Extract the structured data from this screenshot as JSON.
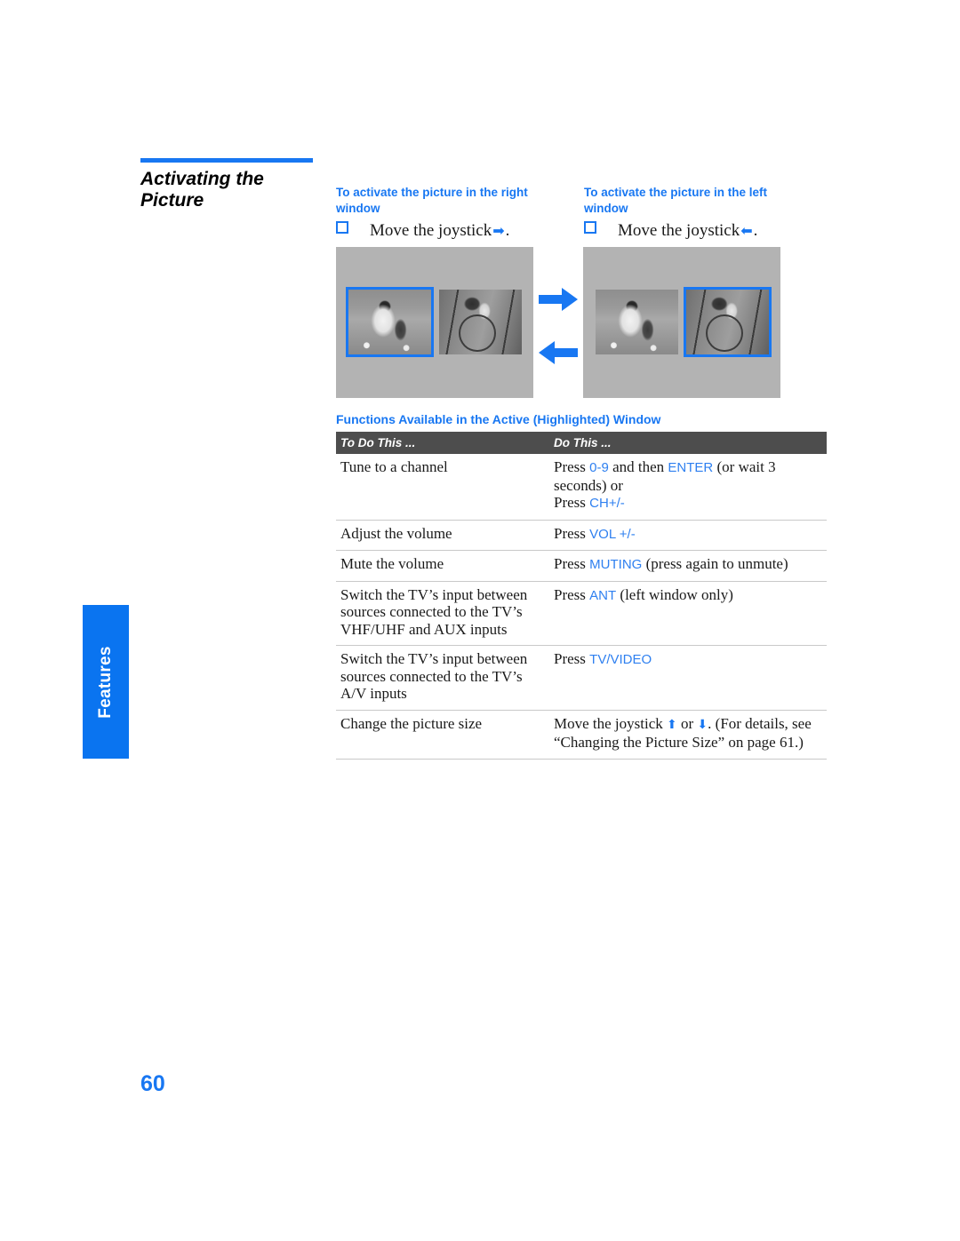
{
  "side_tab": {
    "label": "Features"
  },
  "heading": {
    "line1": "Activating the",
    "line2": "Picture"
  },
  "folio": {
    "page_number": "60"
  },
  "colors": {
    "accent_blue": "#1877f2",
    "keyword_blue": "#2f80f0",
    "table_header_gray": "#4d4d4d",
    "panel_gray": "#b3b3b3"
  },
  "instructions": [
    {
      "title": "To activate the picture in the right window",
      "bullet_icon": "empty-square-bullet",
      "text_before": "Move the joystick",
      "arrow_icon": "arrow-right-icon",
      "arrow_glyph": "➡",
      "text_after": "."
    },
    {
      "title": "To activate the picture in the left window",
      "bullet_icon": "empty-square-bullet",
      "text_before": "Move the joystick",
      "arrow_icon": "arrow-left-icon",
      "arrow_glyph": "⬅",
      "text_after": "."
    }
  ],
  "figures": {
    "left_panel": {
      "caption_role": "left-window-highlighted",
      "thumb_left": "soccer-photo",
      "thumb_right": "basketball-photo",
      "highlighted": "left"
    },
    "right_panel": {
      "caption_role": "right-window-highlighted",
      "thumb_left": "soccer-photo",
      "thumb_right": "basketball-photo",
      "highlighted": "right"
    },
    "arrows": {
      "top": "arrow-right-icon",
      "bottom": "arrow-left-icon"
    }
  },
  "table": {
    "caption": "Functions Available in the Active (Highlighted) Window",
    "headers": [
      "To Do This ...",
      "Do This ..."
    ],
    "rows": [
      {
        "to_do": "Tune to a channel",
        "do_this_parts": [
          {
            "t": "Press ",
            "k": false
          },
          {
            "t": "0-9",
            "k": true
          },
          {
            "t": " and then ",
            "k": false
          },
          {
            "t": "ENTER",
            "k": true
          },
          {
            "t": " (or wait 3 seconds) or",
            "k": false
          },
          {
            "t": "\n",
            "k": false
          },
          {
            "t": "Press ",
            "k": false
          },
          {
            "t": "CH+/-",
            "k": true
          }
        ]
      },
      {
        "to_do": "Adjust the volume",
        "do_this_parts": [
          {
            "t": "Press ",
            "k": false
          },
          {
            "t": "VOL +/-",
            "k": true
          }
        ]
      },
      {
        "to_do": "Mute the volume",
        "do_this_parts": [
          {
            "t": "Press ",
            "k": false
          },
          {
            "t": "MUTING",
            "k": true
          },
          {
            "t": " (press again to unmute)",
            "k": false
          }
        ]
      },
      {
        "to_do": "Switch the TV’s input between sources connected to the TV’s VHF/UHF and AUX inputs",
        "do_this_parts": [
          {
            "t": "Press ",
            "k": false
          },
          {
            "t": "ANT",
            "k": true
          },
          {
            "t": " (left window only)",
            "k": false
          }
        ]
      },
      {
        "to_do": "Switch the TV’s input between sources connected to the TV’s A/V inputs",
        "do_this_parts": [
          {
            "t": "Press ",
            "k": false
          },
          {
            "t": "TV/VIDEO",
            "k": true
          }
        ]
      },
      {
        "to_do": "Change the picture size",
        "do_this_parts": [
          {
            "t": "Move the joystick ",
            "k": false
          },
          {
            "t": "⬆",
            "k": false,
            "arrow": true
          },
          {
            "t": " or ",
            "k": false
          },
          {
            "t": "⬇",
            "k": false,
            "arrow": true
          },
          {
            "t": ". (For details, see “Changing the Picture Size” on page 61.)",
            "k": false
          }
        ]
      }
    ]
  }
}
